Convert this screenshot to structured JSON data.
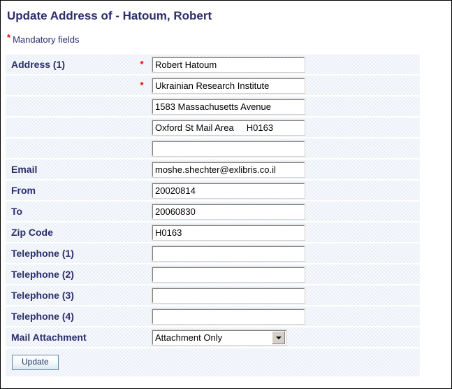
{
  "page": {
    "title": "Update Address of - Hatoum, Robert",
    "mandatory_note": "Mandatory fields",
    "mandatory_marker": "*",
    "colors": {
      "title": "#2b2d6e",
      "label": "#2b2d6e",
      "required_star": "#ee0000",
      "row_background": "#e3eaf4",
      "button_border": "#5b87a8",
      "button_text": "#15356b",
      "page_border": "#000000"
    }
  },
  "form": {
    "rows": [
      {
        "label": "Address (1)",
        "required": true,
        "star": "*",
        "control": "text",
        "value": "Robert Hatoum",
        "placeholder": ""
      },
      {
        "label": "",
        "required": true,
        "star": "*",
        "control": "text",
        "value": "Ukrainian Research Institute",
        "placeholder": ""
      },
      {
        "label": "",
        "required": false,
        "star": "",
        "control": "text",
        "value": "1583 Massachusetts Avenue",
        "placeholder": ""
      },
      {
        "label": "",
        "required": false,
        "star": "",
        "control": "text",
        "value": "Oxford St Mail Area     H0163",
        "placeholder": ""
      },
      {
        "label": "",
        "required": false,
        "star": "",
        "control": "text",
        "value": "",
        "placeholder": ""
      },
      {
        "label": "Email",
        "required": false,
        "star": "",
        "control": "text",
        "value": "moshe.shechter@exlibris.co.il",
        "placeholder": ""
      },
      {
        "label": "From",
        "required": false,
        "star": "",
        "control": "text",
        "value": "20020814",
        "placeholder": ""
      },
      {
        "label": "To",
        "required": false,
        "star": "",
        "control": "text",
        "value": "20060830",
        "placeholder": ""
      },
      {
        "label": "Zip Code",
        "required": false,
        "star": "",
        "control": "text",
        "value": "H0163",
        "placeholder": ""
      },
      {
        "label": "Telephone (1)",
        "required": false,
        "star": "",
        "control": "text",
        "value": "",
        "placeholder": ""
      },
      {
        "label": "Telephone (2)",
        "required": false,
        "star": "",
        "control": "text",
        "value": "",
        "placeholder": ""
      },
      {
        "label": "Telephone (3)",
        "required": false,
        "star": "",
        "control": "text",
        "value": "",
        "placeholder": ""
      },
      {
        "label": "Telephone (4)",
        "required": false,
        "star": "",
        "control": "text",
        "value": "",
        "placeholder": ""
      },
      {
        "label": "Mail Attachment",
        "required": false,
        "star": "",
        "control": "select",
        "value": "Attachment Only",
        "placeholder": ""
      }
    ]
  },
  "footer": {
    "update_label": "Update"
  }
}
